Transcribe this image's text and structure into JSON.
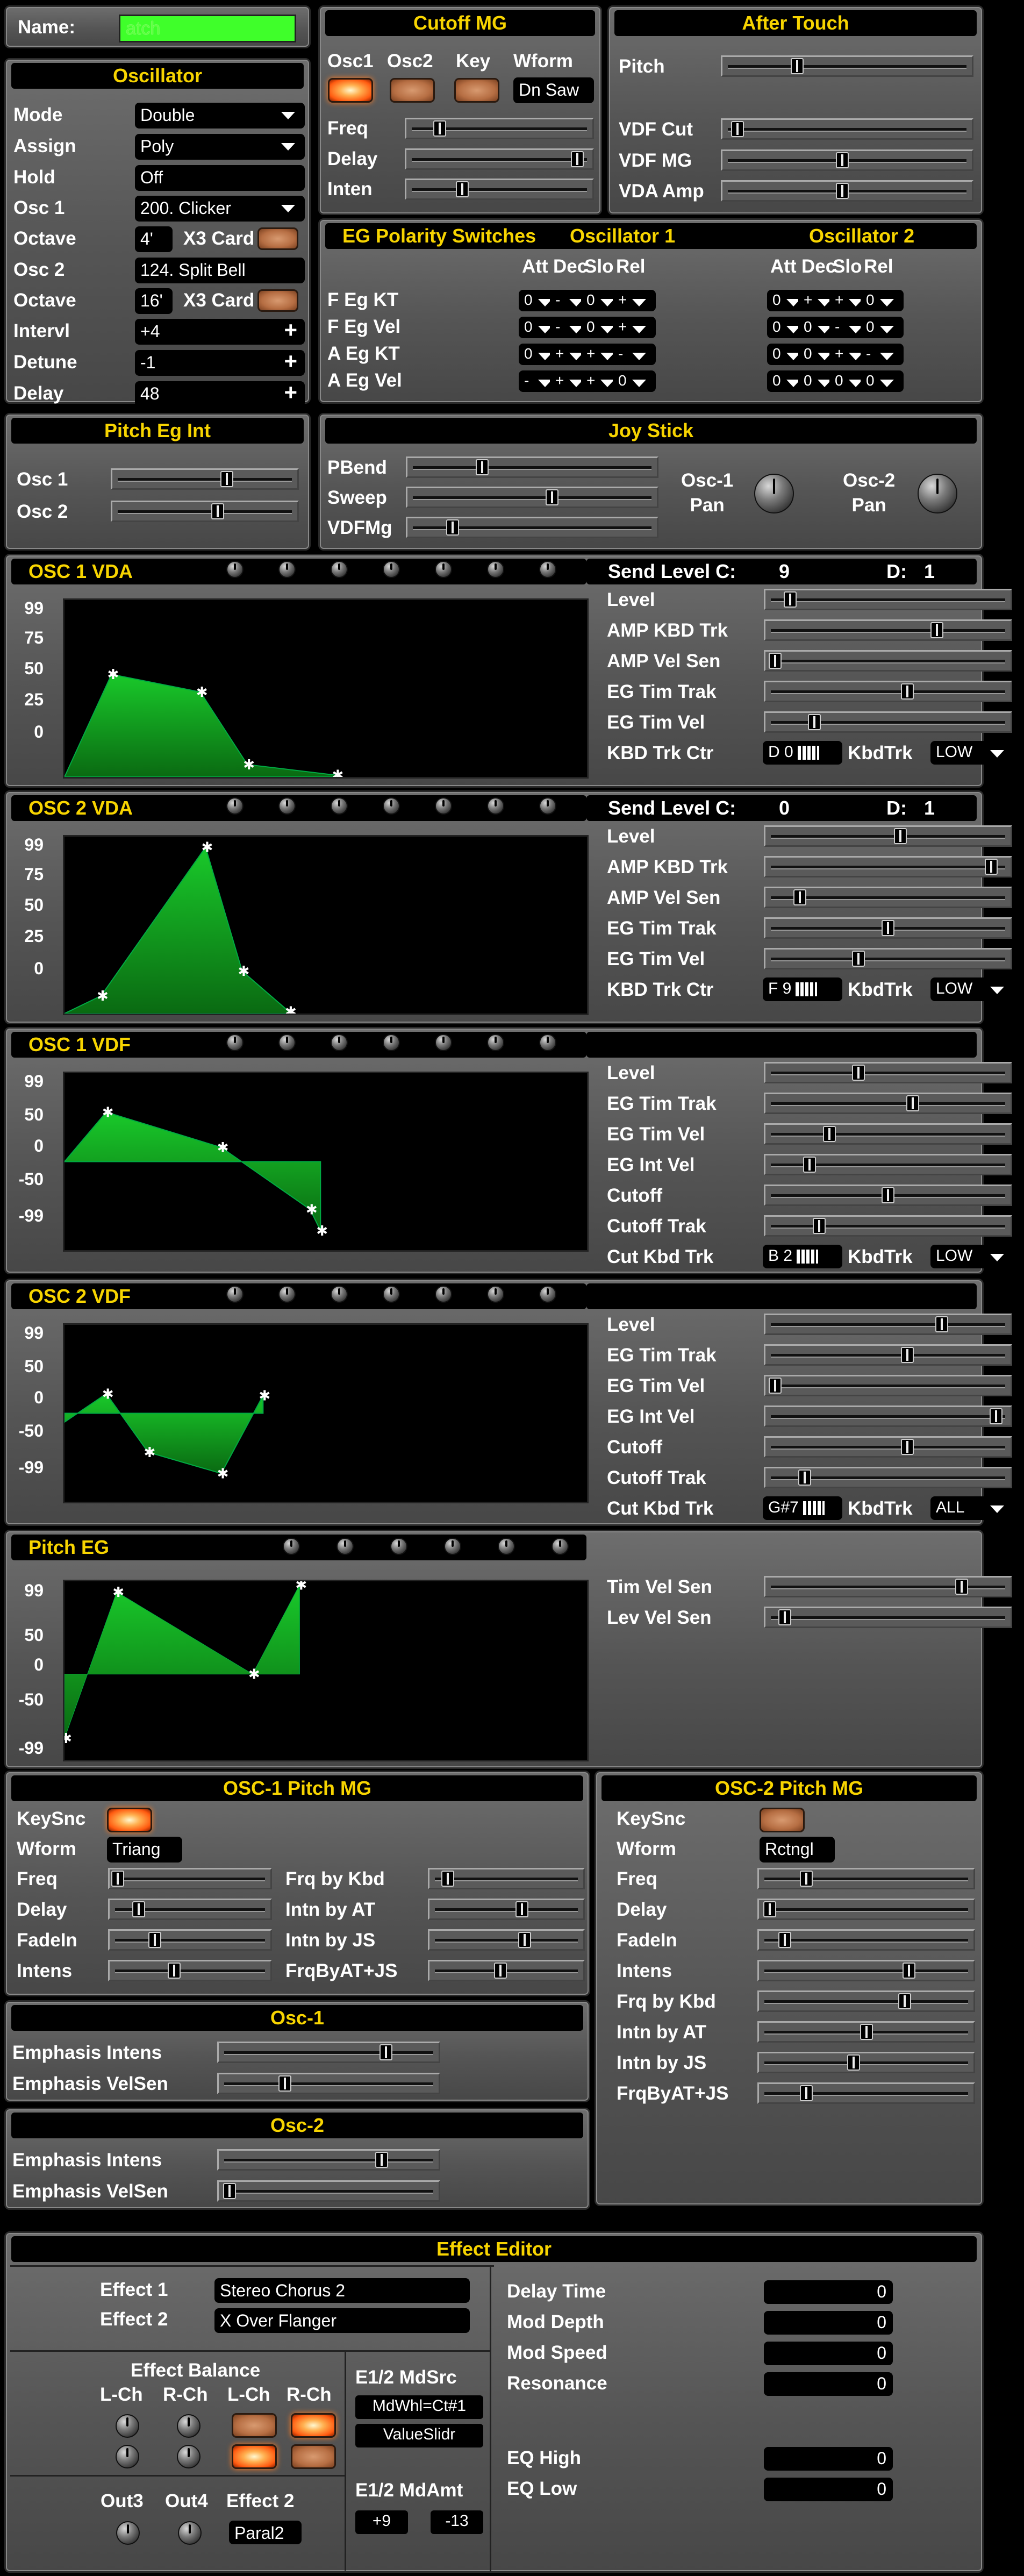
{
  "name": {
    "label": "Name:",
    "value": "atch"
  },
  "oscillator": {
    "title": "Oscillator",
    "rows": [
      {
        "label": "Mode",
        "value": "Double"
      },
      {
        "label": "Assign",
        "value": "Poly"
      },
      {
        "label": "Hold",
        "value": "Off"
      },
      {
        "label": "Osc 1",
        "value": "200. Clicker"
      },
      {
        "label": "Octave",
        "value": "4'",
        "card": "X3 Card"
      },
      {
        "label": "Osc 2",
        "value": "124. Split Bell"
      },
      {
        "label": "Octave",
        "value": "16'",
        "card": "X3 Card"
      },
      {
        "label": "Intervl",
        "value": "+4"
      },
      {
        "label": "Detune",
        "value": "-1"
      },
      {
        "label": "Delay",
        "value": "48"
      }
    ]
  },
  "cutoff_mg": {
    "title": "Cutoff MG",
    "cols": [
      "Osc1",
      "Osc2",
      "Key",
      "Wform"
    ],
    "wform": "Dn Saw",
    "rows": [
      "Freq",
      "Delay",
      "Inten"
    ]
  },
  "after_touch": {
    "title": "After Touch",
    "rows": [
      "Pitch",
      "VDF Cut",
      "VDF MG",
      "VDA Amp"
    ]
  },
  "eg_polarity": {
    "title": "EG Polarity Switches",
    "osc1": "Oscillator 1",
    "osc2": "Oscillator 2",
    "cols": [
      "Att",
      "Dec",
      "Slo",
      "Rel"
    ],
    "rows": [
      {
        "label": "F Eg KT",
        "o1": [
          "0",
          "-",
          "0",
          "+"
        ],
        "o2": [
          "0",
          "+",
          "+",
          "0"
        ]
      },
      {
        "label": "F Eg Vel",
        "o1": [
          "0",
          "-",
          "0",
          "+"
        ],
        "o2": [
          "0",
          "0",
          "-",
          "0"
        ]
      },
      {
        "label": "A Eg KT",
        "o1": [
          "0",
          "+",
          "+",
          "-"
        ],
        "o2": [
          "0",
          "0",
          "+",
          "-"
        ]
      },
      {
        "label": "A Eg Vel",
        "o1": [
          "-",
          "+",
          "+",
          "0"
        ],
        "o2": [
          "0",
          "0",
          "0",
          "0"
        ]
      }
    ]
  },
  "pitch_eg_int": {
    "title": "Pitch Eg Int",
    "rows": [
      "Osc 1",
      "Osc 2"
    ]
  },
  "joystick": {
    "title": "Joy Stick",
    "rows": [
      "PBend",
      "Sweep",
      "VDFMg"
    ],
    "osc1_pan": "Osc-1\nPan",
    "osc2_pan": "Osc-2\nPan"
  },
  "osc1_vda": {
    "title": "OSC 1 VDA",
    "send": "Send Level  C:",
    "c": "9",
    "d_label": "D:",
    "d": "1",
    "axis": [
      "99",
      "75",
      "50",
      "25",
      "0"
    ],
    "rows": [
      "Level",
      "AMP KBD Trk",
      "AMP Vel Sen",
      "EG Tim Trak",
      "EG Tim Vel"
    ],
    "kbd_label": "KBD Trk Ctr",
    "kbd_value": "D 0",
    "kbdtrk": "KbdTrk",
    "mode": "LOW"
  },
  "osc2_vda": {
    "title": "OSC 2 VDA",
    "send": "Send Level  C:",
    "c": "0",
    "d_label": "D:",
    "d": "1",
    "axis": [
      "99",
      "75",
      "50",
      "25",
      "0"
    ],
    "rows": [
      "Level",
      "AMP KBD Trk",
      "AMP Vel Sen",
      "EG Tim Trak",
      "EG Tim Vel"
    ],
    "kbd_label": "KBD Trk Ctr",
    "kbd_value": "F 9",
    "kbdtrk": "KbdTrk",
    "mode": "LOW"
  },
  "osc1_vdf": {
    "title": "OSC 1 VDF",
    "axis": [
      "99",
      "50",
      "0",
      "-50",
      "-99"
    ],
    "rows": [
      "Level",
      "EG Tim Trak",
      "EG Tim Vel",
      "EG Int Vel",
      "Cutoff",
      "Cutoff Trak"
    ],
    "kbd_label": "Cut Kbd Trk",
    "kbd_value": "B 2",
    "kbdtrk": "KbdTrk",
    "mode": "LOW"
  },
  "osc2_vdf": {
    "title": "OSC 2 VDF",
    "axis": [
      "99",
      "50",
      "0",
      "-50",
      "-99"
    ],
    "rows": [
      "Level",
      "EG Tim Trak",
      "EG Tim Vel",
      "EG Int Vel",
      "Cutoff",
      "Cutoff Trak"
    ],
    "kbd_label": "Cut Kbd Trk",
    "kbd_value": "G#7",
    "kbdtrk": "KbdTrk",
    "mode": "ALL"
  },
  "pitch_eg": {
    "title": "Pitch EG",
    "axis": [
      "99",
      "50",
      "0",
      "-50",
      "-99"
    ],
    "rows": [
      "Tim Vel Sen",
      "Lev Vel Sen"
    ]
  },
  "osc1_pitch_mg": {
    "title": "OSC-1 Pitch MG",
    "keysnc": "KeySnc",
    "wform_label": "Wform",
    "wform": "Triang",
    "left": [
      "Freq",
      "Delay",
      "FadeIn",
      "Intens"
    ],
    "right": [
      "Frq by Kbd",
      "Intn by AT",
      "Intn by JS",
      "FrqByAT+JS"
    ]
  },
  "osc2_pitch_mg": {
    "title": "OSC-2 Pitch MG",
    "keysnc": "KeySnc",
    "wform_label": "Wform",
    "wform": "Rctngl",
    "rows": [
      "Freq",
      "Delay",
      "FadeIn",
      "Intens",
      "Frq by Kbd",
      "Intn by AT",
      "Intn by JS",
      "FrqByAT+JS"
    ]
  },
  "osc1": {
    "title": "Osc-1",
    "rows": [
      "Emphasis Intens",
      "Emphasis VelSen"
    ]
  },
  "osc2": {
    "title": "Osc-2",
    "rows": [
      "Emphasis Intens",
      "Emphasis VelSen"
    ]
  },
  "effect": {
    "title": "Effect Editor",
    "e1_label": "Effect 1",
    "e1": "Stereo Chorus 2",
    "e2_label": "Effect 2",
    "e2": "X Over Flanger",
    "params": [
      {
        "label": "Delay Time",
        "value": "0"
      },
      {
        "label": "Mod Depth",
        "value": "0"
      },
      {
        "label": "Mod Speed",
        "value": "0"
      },
      {
        "label": "Resonance",
        "value": "0"
      }
    ],
    "eq": [
      {
        "label": "EQ High",
        "value": "0"
      },
      {
        "label": "EQ Low",
        "value": "0"
      }
    ],
    "balance": "Effect Balance",
    "bal_cols": [
      "L-Ch",
      "R-Ch",
      "L-Ch",
      "R-Ch"
    ],
    "mdsrc_label": "E1/2 MdSrc",
    "mdsrc1": "MdWhl=Ct#1",
    "mdsrc2": "ValueSlidr",
    "mdamt_label": "E1/2 MdAmt",
    "mdamt1": "+9",
    "mdamt2": "-13",
    "out3": "Out3",
    "out4": "Out4",
    "e2b_label": "Effect 2",
    "e2b": "Paral2"
  }
}
